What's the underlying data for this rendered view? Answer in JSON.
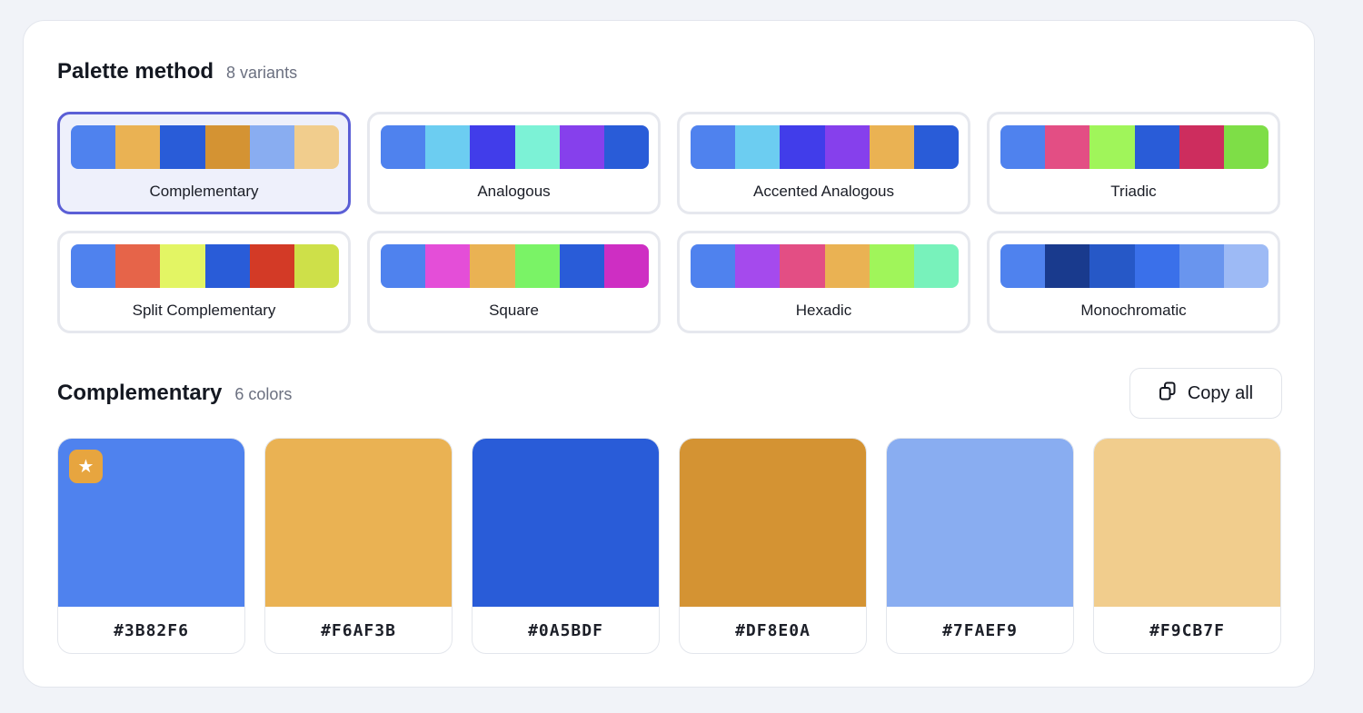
{
  "palette_method": {
    "title": "Palette method",
    "count": "8 variants",
    "selected": "Complementary",
    "methods": [
      {
        "label": "Complementary",
        "colors": [
          "#4F82EE",
          "#EAB253",
          "#295CD8",
          "#D49333",
          "#89ADF1",
          "#F1CD8D"
        ]
      },
      {
        "label": "Analogous",
        "colors": [
          "#4F82EE",
          "#6CCDF1",
          "#413DEA",
          "#7CF2D6",
          "#8640EC",
          "#295CD8"
        ]
      },
      {
        "label": "Accented Analogous",
        "colors": [
          "#4F82EE",
          "#6CCDF1",
          "#413DEA",
          "#8640EC",
          "#EAB253",
          "#295CD8"
        ]
      },
      {
        "label": "Triadic",
        "colors": [
          "#4F82EE",
          "#E34E84",
          "#A0F55A",
          "#295CD8",
          "#CD2D5E",
          "#7EDE47"
        ]
      },
      {
        "label": "Split Complementary",
        "colors": [
          "#4F82EE",
          "#E66449",
          "#E3F564",
          "#295CD8",
          "#D33A26",
          "#CEE049"
        ]
      },
      {
        "label": "Square",
        "colors": [
          "#4F82EE",
          "#E44ED8",
          "#EAB253",
          "#7AF366",
          "#295CD8",
          "#CE2EC3"
        ]
      },
      {
        "label": "Hexadic",
        "colors": [
          "#4F82EE",
          "#A54AED",
          "#E34E84",
          "#EAB253",
          "#A0F55A",
          "#78F2BB"
        ]
      },
      {
        "label": "Monochromatic",
        "colors": [
          "#4F82EE",
          "#193A8D",
          "#2658C7",
          "#3A70EA",
          "#6995EE",
          "#9DBAF5"
        ]
      }
    ]
  },
  "palette": {
    "title": "Complementary",
    "count": "6 colors",
    "copy_all_label": "Copy all",
    "swatches": [
      {
        "hex": "#3B82F6",
        "display": "#4F82EE",
        "starred": true
      },
      {
        "hex": "#F6AF3B",
        "display": "#EAB253",
        "starred": false
      },
      {
        "hex": "#0A5BDF",
        "display": "#295CD8",
        "starred": false
      },
      {
        "hex": "#DF8E0A",
        "display": "#D49333",
        "starred": false
      },
      {
        "hex": "#7FAEF9",
        "display": "#89ADF1",
        "starred": false
      },
      {
        "hex": "#F9CB7F",
        "display": "#F1CD8D",
        "starred": false
      }
    ]
  }
}
